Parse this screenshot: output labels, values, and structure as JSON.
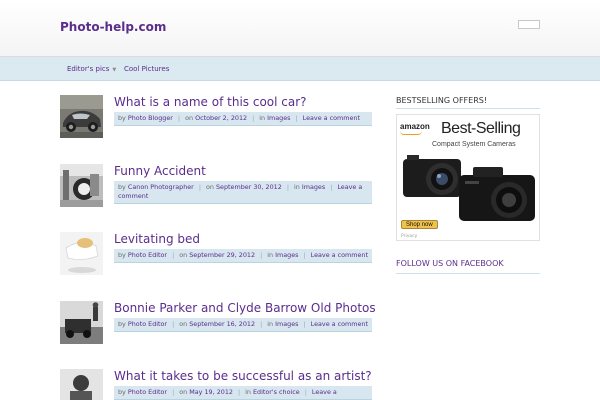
{
  "header": {
    "site_title": "Photo-help.com"
  },
  "nav": {
    "items": [
      {
        "label": "Editor's pics",
        "has_dropdown": true
      },
      {
        "label": "Cool Pictures",
        "has_dropdown": false
      }
    ]
  },
  "posts": [
    {
      "title": "What is a name of this cool car?",
      "author": "Photo Blogger",
      "date_prefix": "on",
      "date": "October 2, 2012",
      "cat_prefix": "in",
      "category": "Images",
      "comment": "Leave a comment"
    },
    {
      "title": "Funny Accident",
      "author": "Canon Photographer",
      "date_prefix": "on",
      "date": "September 30, 2012",
      "cat_prefix": "in",
      "category": "Images",
      "comment": "Leave a comment"
    },
    {
      "title": "Levitating bed",
      "author": "Photo Editor",
      "date_prefix": "on",
      "date": "September 29, 2012",
      "cat_prefix": "in",
      "category": "Images",
      "comment": "Leave a comment"
    },
    {
      "title": "Bonnie Parker and Clyde Barrow Old Photos",
      "author": "Photo Editor",
      "date_prefix": "on",
      "date": "September 16, 2012",
      "cat_prefix": "in",
      "category": "Images",
      "comment": "Leave a comment"
    },
    {
      "title": "What it takes to be successful as an artist?",
      "author": "Photo Editor",
      "date_prefix": "on",
      "date": "May 19, 2012",
      "cat_prefix": "in",
      "category": "Editor's choice",
      "comment": "Leave a"
    }
  ],
  "meta": {
    "by": "by"
  },
  "sidebar": {
    "offers_title": "BESTSELLING OFFERS!",
    "facebook_title": "FOLLOW US ON FACEBOOK",
    "ad": {
      "brand": "amazon",
      "headline": "Best-Selling",
      "subline": "Compact System Cameras",
      "cta": "Shop now",
      "privacy": "Privacy"
    }
  },
  "colors": {
    "accent": "#5a2d8c",
    "meta_bar": "#d7e6ef",
    "nav_bar": "#dbe9f0"
  }
}
